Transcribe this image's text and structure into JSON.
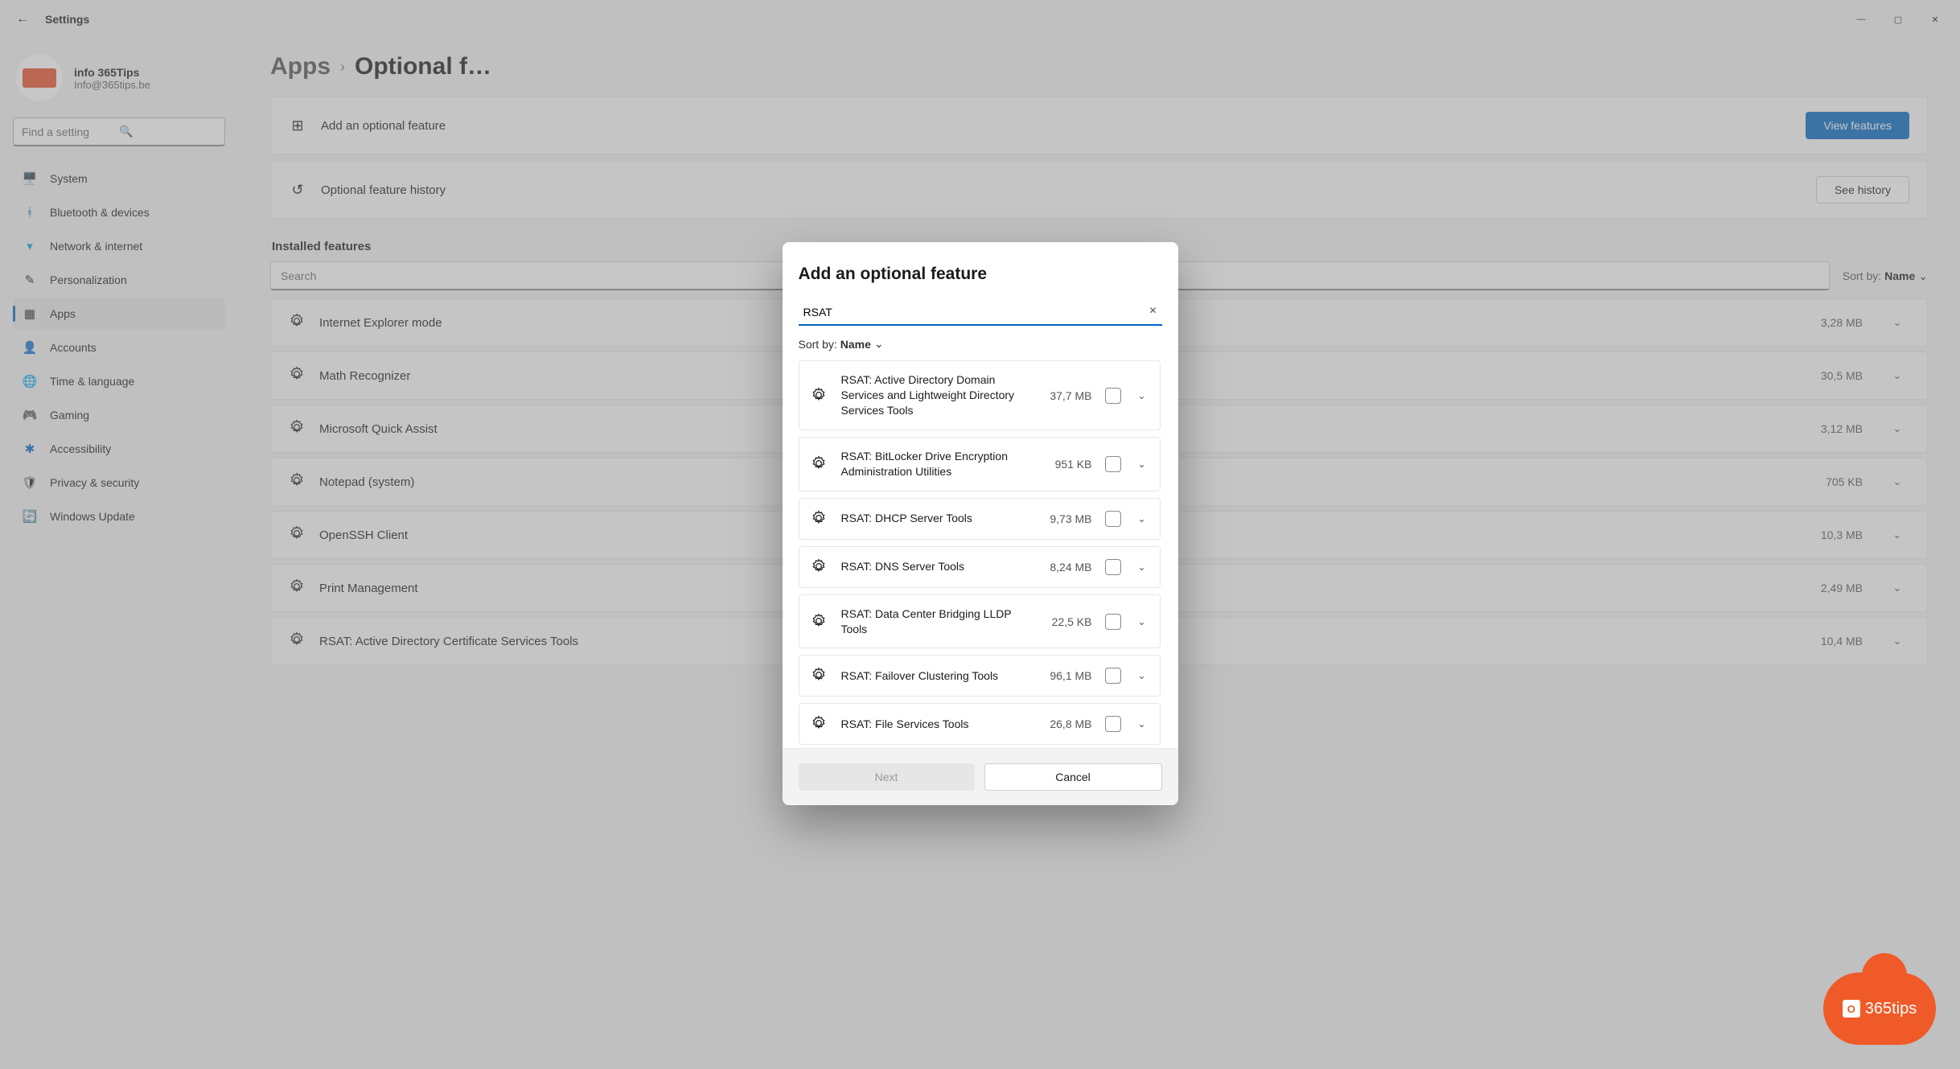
{
  "window": {
    "title": "Settings",
    "controls": {
      "minimize": "—",
      "maximize": "▢",
      "close": "✕"
    }
  },
  "profile": {
    "name": "info 365Tips",
    "email": "Info@365tips.be"
  },
  "search_placeholder": "Find a setting",
  "nav": [
    {
      "icon": "🖥️",
      "label": "System"
    },
    {
      "icon": "ᚼ",
      "label": "Bluetooth & devices",
      "iconcolor": "#0067c0"
    },
    {
      "icon": "▾",
      "label": "Network & internet",
      "iconcolor": "#0aa5de"
    },
    {
      "icon": "✎",
      "label": "Personalization"
    },
    {
      "icon": "▦",
      "label": "Apps",
      "active": true
    },
    {
      "icon": "👤",
      "label": "Accounts"
    },
    {
      "icon": "🌐",
      "label": "Time & language"
    },
    {
      "icon": "🎮",
      "label": "Gaming"
    },
    {
      "icon": "✱",
      "label": "Accessibility",
      "iconcolor": "#0067c0"
    },
    {
      "icon": "🛡",
      "label": "Privacy & security"
    },
    {
      "icon": "🔄",
      "label": "Windows Update",
      "iconcolor": "#0067c0"
    }
  ],
  "breadcrumb": {
    "parent": "Apps",
    "current": "Optional f…"
  },
  "cards": {
    "add": {
      "label": "Add an optional feature",
      "button": "View features"
    },
    "history": {
      "label": "Optional feature history",
      "button": "See history"
    }
  },
  "installed": {
    "title": "Installed features",
    "search_placeholder": "Search",
    "sort_label": "Sort by:",
    "sort_value": "Name",
    "items": [
      {
        "name": "Internet Explorer mode",
        "size": "3,28 MB"
      },
      {
        "name": "Math Recognizer",
        "size": "30,5 MB"
      },
      {
        "name": "Microsoft Quick Assist",
        "size": "3,12 MB"
      },
      {
        "name": "Notepad (system)",
        "size": "705 KB"
      },
      {
        "name": "OpenSSH Client",
        "size": "10,3 MB"
      },
      {
        "name": "Print Management",
        "size": "2,49 MB"
      },
      {
        "name": "RSAT: Active Directory Certificate Services Tools",
        "size": "10,4 MB"
      }
    ]
  },
  "dialog": {
    "title": "Add an optional feature",
    "input_value": "RSAT",
    "sort_label": "Sort by:",
    "sort_value": "Name",
    "items": [
      {
        "name": "RSAT: Active Directory Domain Services and Lightweight Directory Services Tools",
        "size": "37,7 MB"
      },
      {
        "name": "RSAT: BitLocker Drive Encryption Administration Utilities",
        "size": "951 KB"
      },
      {
        "name": "RSAT: DHCP Server Tools",
        "size": "9,73 MB"
      },
      {
        "name": "RSAT: DNS Server Tools",
        "size": "8,24 MB"
      },
      {
        "name": "RSAT: Data Center Bridging LLDP Tools",
        "size": "22,5 KB"
      },
      {
        "name": "RSAT: Failover Clustering Tools",
        "size": "96,1 MB"
      },
      {
        "name": "RSAT: File Services Tools",
        "size": "26,8 MB"
      }
    ],
    "next": "Next",
    "cancel": "Cancel"
  },
  "logo_text": "365tips"
}
